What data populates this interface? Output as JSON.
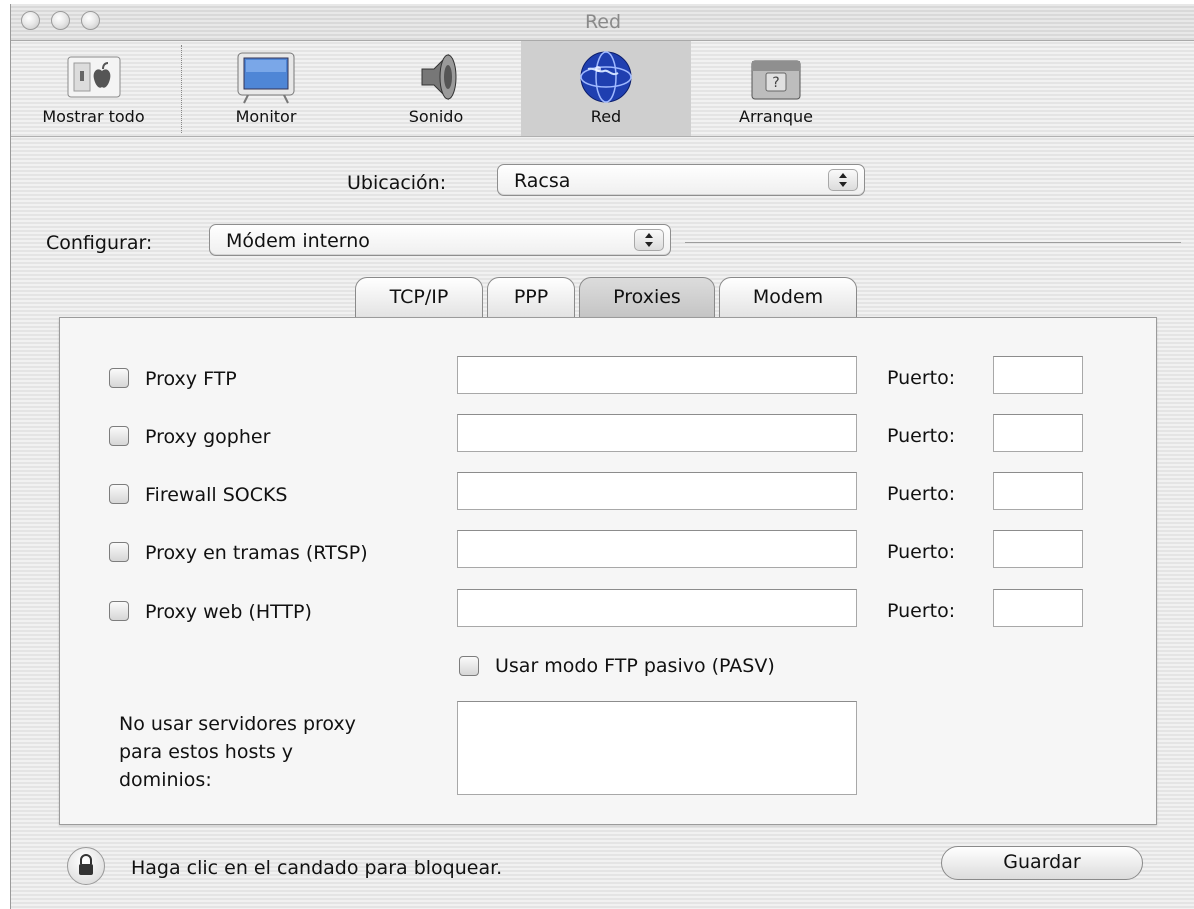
{
  "window": {
    "title": "Red"
  },
  "toolbar": {
    "items": [
      {
        "label": "Mostrar todo",
        "icon": "show-all-icon"
      },
      {
        "label": "Monitor",
        "icon": "monitor-icon"
      },
      {
        "label": "Sonido",
        "icon": "speaker-icon"
      },
      {
        "label": "Red",
        "icon": "globe-icon",
        "selected": true
      },
      {
        "label": "Arranque",
        "icon": "startup-disk-icon"
      }
    ]
  },
  "location": {
    "label": "Ubicación:",
    "value": "Racsa"
  },
  "configure": {
    "label": "Configurar:",
    "value": "Módem interno"
  },
  "tabs": [
    {
      "label": "TCP/IP"
    },
    {
      "label": "PPP"
    },
    {
      "label": "Proxies",
      "selected": true
    },
    {
      "label": "Modem"
    }
  ],
  "proxies": {
    "port_label": "Puerto:",
    "rows": [
      {
        "label": "Proxy FTP",
        "checked": false,
        "host": "",
        "port": ""
      },
      {
        "label": "Proxy gopher",
        "checked": false,
        "host": "",
        "port": ""
      },
      {
        "label": "Firewall SOCKS",
        "checked": false,
        "host": "",
        "port": ""
      },
      {
        "label": "Proxy en tramas (RTSP)",
        "checked": false,
        "host": "",
        "port": ""
      },
      {
        "label": "Proxy web (HTTP)",
        "checked": false,
        "host": "",
        "port": ""
      }
    ],
    "passive_ftp": {
      "label": "Usar modo FTP pasivo (PASV)",
      "checked": false
    },
    "bypass": {
      "line1": "No usar servidores proxy",
      "line2": "para estos hosts y",
      "line3": "dominios:",
      "value": ""
    }
  },
  "footer": {
    "lock_text": "Haga clic en el candado para bloquear.",
    "save_label": "Guardar"
  },
  "colors": {
    "window_bg": "#eaeaea",
    "selected_tool_bg": "#cfcfcf",
    "globe_blue": "#1f3fb0"
  }
}
